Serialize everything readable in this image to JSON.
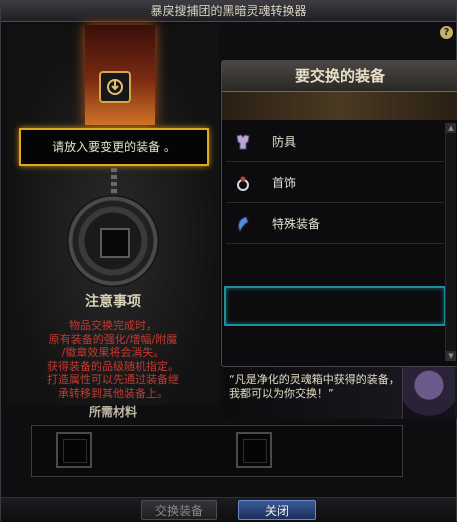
{
  "window": {
    "title": "暴戾搜捕团的黑暗灵魂转换器",
    "help_label": "?"
  },
  "left": {
    "tooltip": "请放入要变更的装备 。",
    "notice_title": "注意事项",
    "notice_lines": [
      "物品交换完成时，",
      "原有装备的强化/增幅/附魔",
      "/徽章效果将会消失。",
      "获得装备的品级随机指定。",
      "打造属性可以先通过装备继",
      "承转移到其他装备上。"
    ],
    "materials_title": "所需材料"
  },
  "right": {
    "header": "要交换的装备",
    "items": [
      {
        "label": "防具",
        "icon": "armor-icon"
      },
      {
        "label": "首饰",
        "icon": "ring-icon"
      },
      {
        "label": "特殊装备",
        "icon": "special-equipment-icon"
      }
    ],
    "scroll_up": "▲",
    "scroll_down": "▼"
  },
  "npc": {
    "quote": "“凡是净化的灵魂箱中获得的装备，我都可以为你交换！”"
  },
  "buttons": {
    "exchange": "交换装备",
    "close": "关闭"
  },
  "colors": {
    "tooltip_border": "#e0a81a",
    "selected_slot": "#1d8f9a",
    "notice_red": "#c23b30",
    "close_button": "#3a5a9a"
  }
}
